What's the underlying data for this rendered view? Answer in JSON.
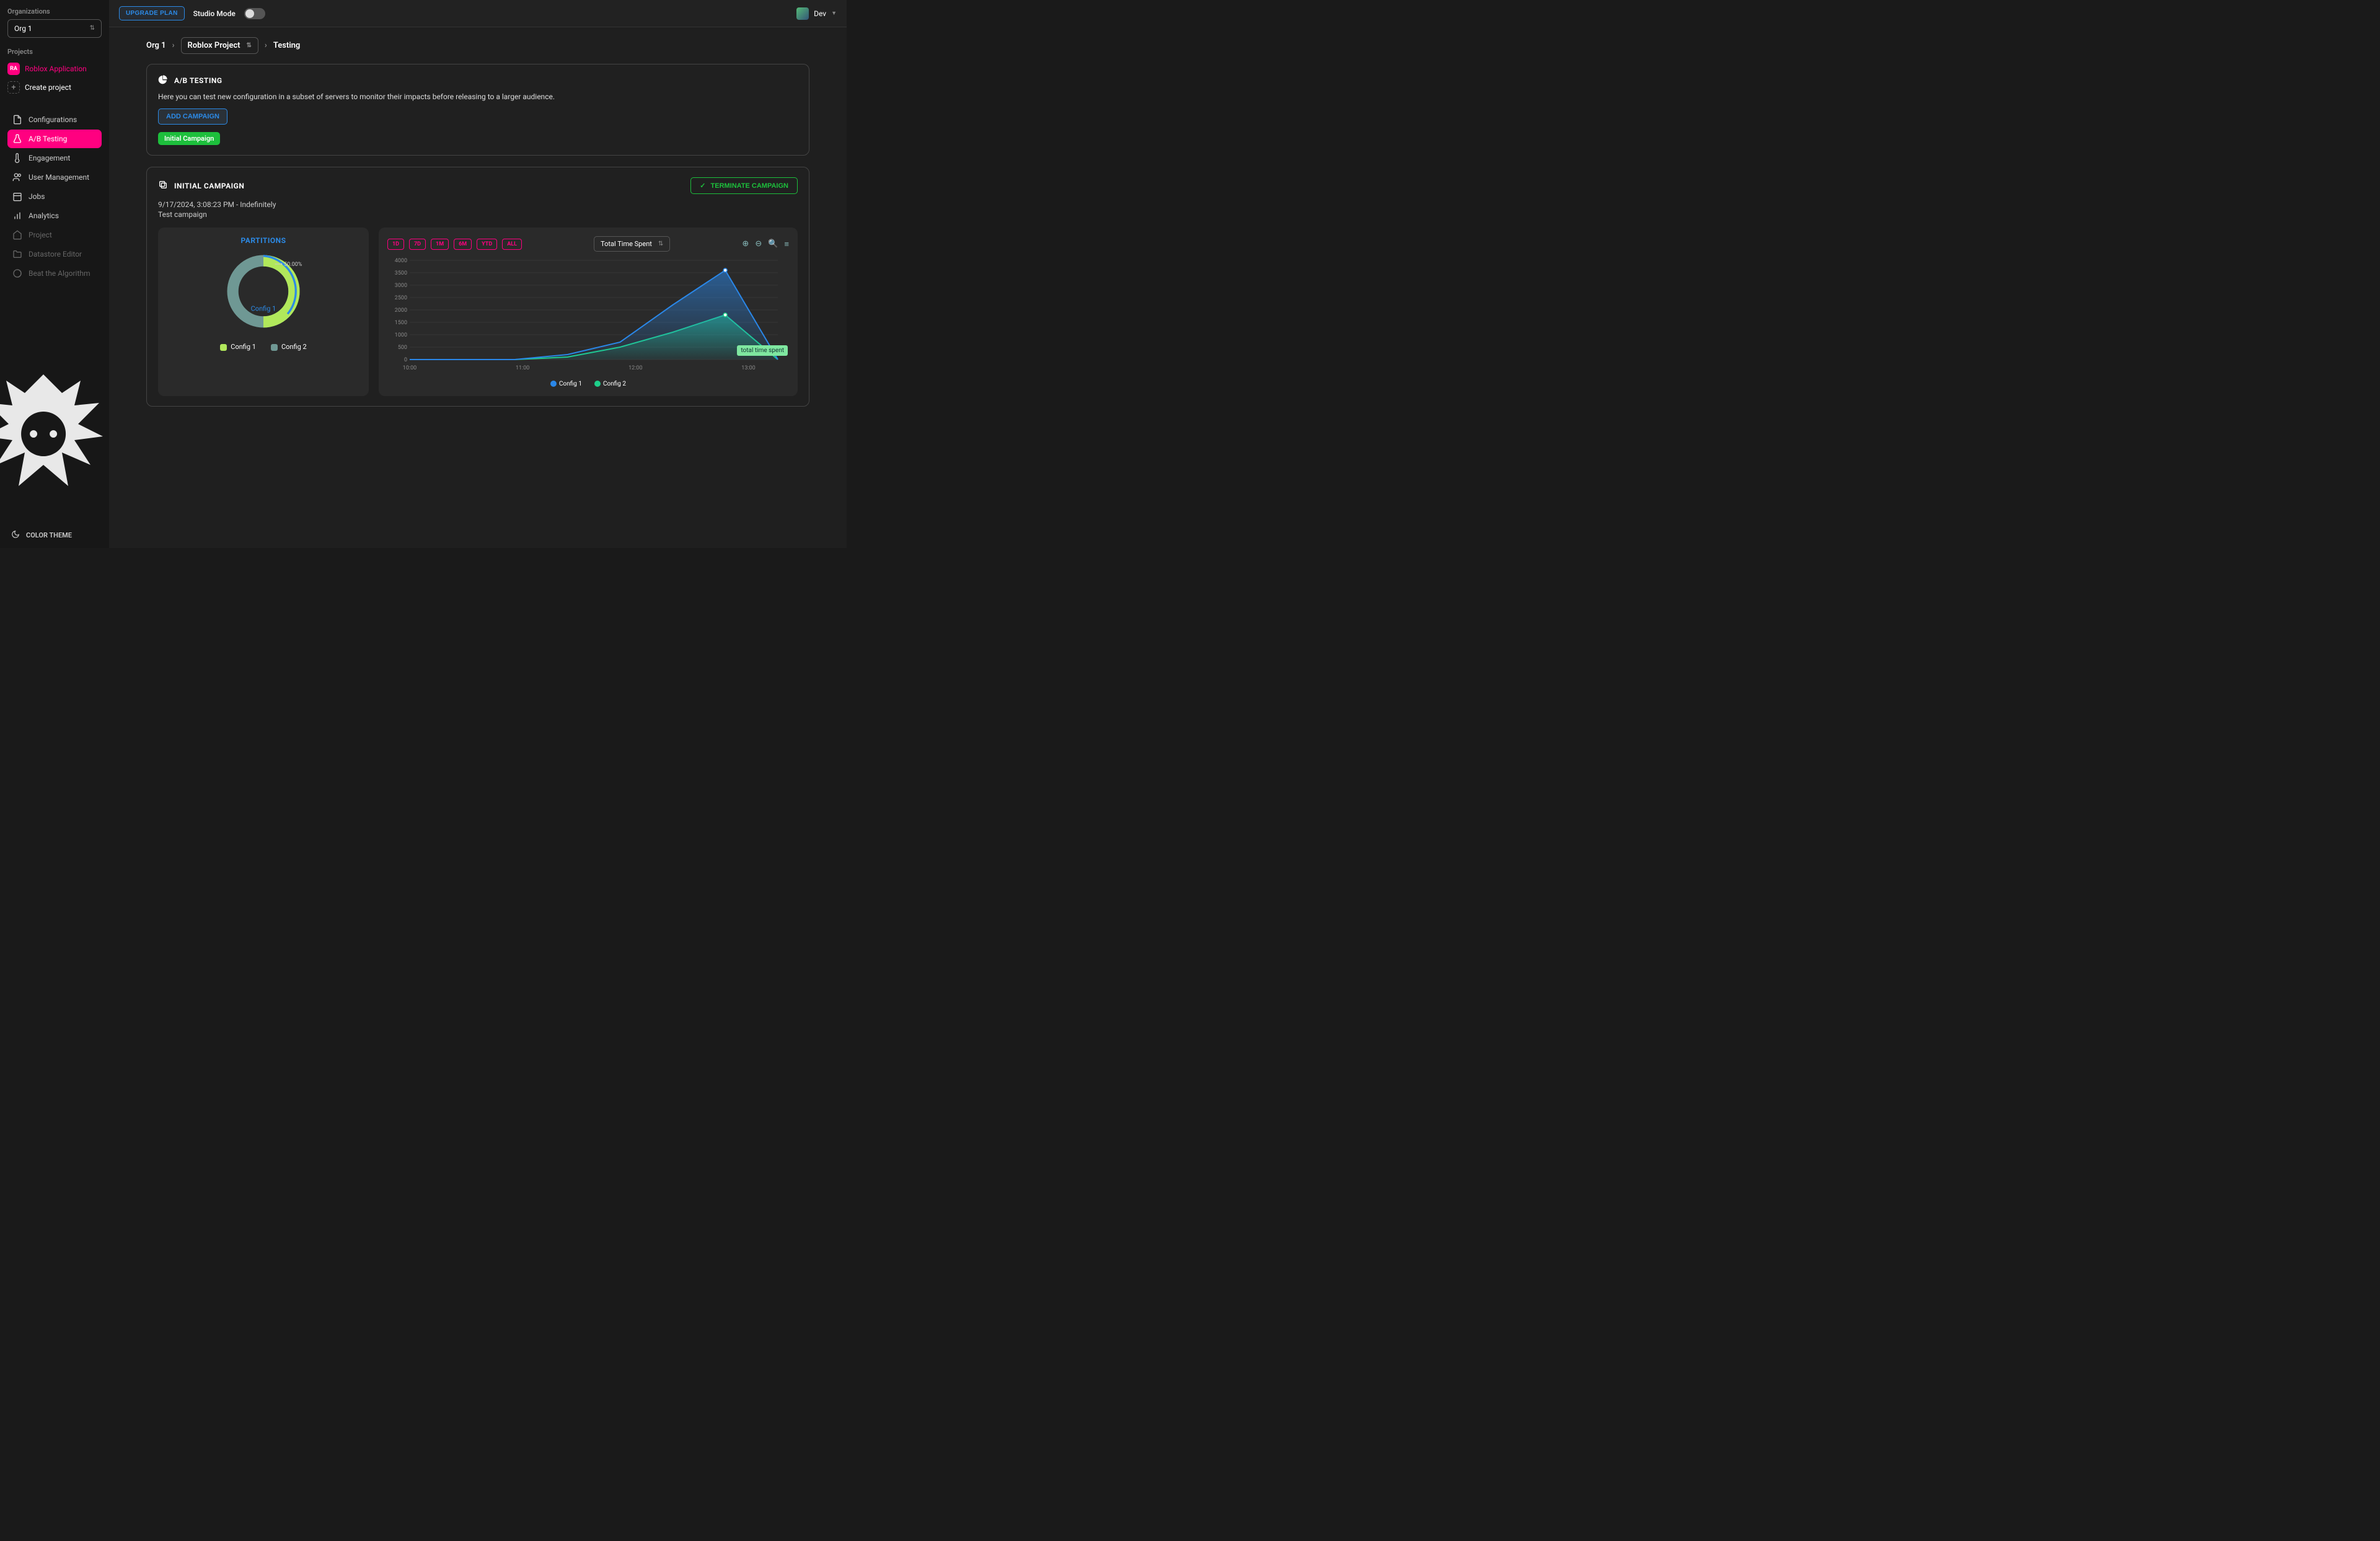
{
  "sidebar": {
    "org_label": "Organizations",
    "org_selected": "Org 1",
    "projects_label": "Projects",
    "project_active_avatar": "RA",
    "project_active_name": "Roblox Application",
    "create_project_label": "Create project",
    "nav": [
      {
        "label": "Configurations",
        "icon": "file"
      },
      {
        "label": "A/B Testing",
        "icon": "beaker",
        "active": true
      },
      {
        "label": "Engagement",
        "icon": "thermometer"
      },
      {
        "label": "User Management",
        "icon": "users"
      },
      {
        "label": "Jobs",
        "icon": "calendar"
      },
      {
        "label": "Analytics",
        "icon": "bar"
      }
    ],
    "nav_disabled": [
      {
        "label": "Project",
        "icon": "home"
      },
      {
        "label": "Datastore Editor",
        "icon": "folder"
      },
      {
        "label": "Beat the Algorithm",
        "icon": "target"
      }
    ],
    "theme_label": "COLOR THEME"
  },
  "topbar": {
    "upgrade": "UPGRADE PLAN",
    "studio_mode": "Studio Mode",
    "username": "Dev"
  },
  "breadcrumb": {
    "org": "Org 1",
    "project": "Roblox Project",
    "page": "Testing"
  },
  "ab_panel": {
    "title": "A/B TESTING",
    "desc": "Here you can test new configuration in a subset of servers to monitor their impacts before releasing to a larger audience.",
    "add_campaign": "ADD CAMPAIGN",
    "campaign_pill": "Initial Campaign"
  },
  "campaign": {
    "title": "INITIAL CAMPAIGN",
    "terminate": "TERMINATE CAMPAIGN",
    "timestamp": "9/17/2024, 3:08:23 PM - Indefinitely",
    "desc": "Test campaign"
  },
  "partitions": {
    "title": "PARTITIONS",
    "center_label": "Config 1",
    "pct_label": "50.00%",
    "legend": [
      {
        "label": "Config 1",
        "color": "#b1e85b"
      },
      {
        "label": "Config 2",
        "color": "#6f9894"
      }
    ]
  },
  "chart_controls": {
    "ranges": [
      "1D",
      "7D",
      "1M",
      "6M",
      "YTD",
      "ALL"
    ],
    "metric": "Total Time Spent",
    "tooltip": "total time spent"
  },
  "chart_data": {
    "type": "area",
    "x": [
      "10:00",
      "10:30",
      "11:00",
      "11:30",
      "12:00",
      "12:30",
      "13:00",
      "13:30"
    ],
    "series": [
      {
        "name": "Config 1",
        "color": "#2a87e8",
        "values": [
          0,
          0,
          0,
          200,
          700,
          2200,
          3600,
          0
        ]
      },
      {
        "name": "Config 2",
        "color": "#1ecf8a",
        "values": [
          0,
          0,
          0,
          100,
          500,
          1100,
          1800,
          0
        ]
      }
    ],
    "ylim": [
      0,
      4000
    ],
    "yticks": [
      0,
      500,
      1000,
      1500,
      2000,
      2500,
      3000,
      3500,
      4000
    ],
    "xlabels": [
      "10:00",
      "11:00",
      "12:00",
      "13:00"
    ]
  },
  "colors": {
    "accent": "#ff0080",
    "blue": "#2c8ae6",
    "green": "#1dbf3c"
  }
}
